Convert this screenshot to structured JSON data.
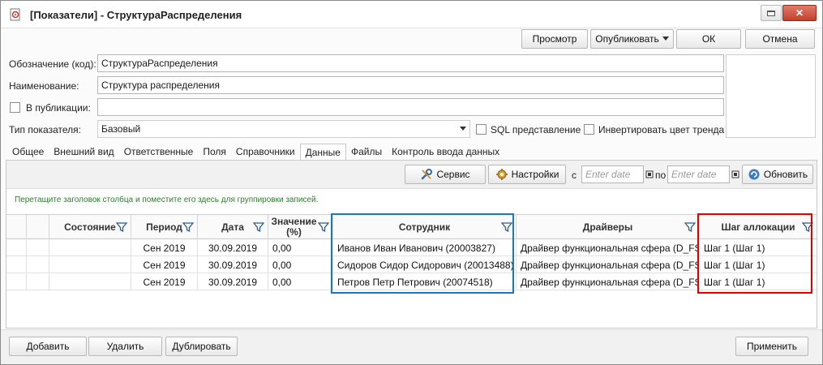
{
  "window": {
    "title": "[Показатели] - СтруктураРаспределения",
    "minimize_icon": "minimize-icon",
    "close_label": "✕"
  },
  "top_buttons": {
    "preview": "Просмотр",
    "publish": "Опубликовать",
    "ok": "ОК",
    "cancel": "Отмена"
  },
  "form": {
    "code_label": "Обозначение (код):",
    "code_value": "СтруктураРаспределения",
    "name_label": "Наименование:",
    "name_value": "Структура распределения",
    "publish_label": "В публикации:",
    "publish_value": "",
    "type_label": "Тип показателя:",
    "type_value": "Базовый",
    "sql_label": "SQL представление",
    "invert_label": "Инвертировать цвет тренда"
  },
  "tabs": [
    "Общее",
    "Внешний вид",
    "Ответственные",
    "Поля",
    "Справочники",
    "Данные",
    "Файлы",
    "Контроль ввода данных"
  ],
  "active_tab": "Данные",
  "toolbar": {
    "service": "Сервис",
    "settings": "Настройки",
    "from": "с",
    "date_placeholder": "Enter date",
    "to": "по",
    "refresh": "Обновить"
  },
  "group_hint": "Перетащите заголовок столбца и поместите его здесь для группировки записей.",
  "grid": {
    "columns": [
      "Состояние",
      "Период",
      "Дата",
      "Значение (%)",
      "Сотрудник",
      "Драйверы",
      "Шаг аллокации"
    ],
    "rows": [
      [
        "",
        "Сен 2019",
        "30.09.2019",
        "0,00",
        "Иванов Иван Иванович (20003827)",
        "Драйвер функциональная сфера (D_FS)",
        "Шаг 1 (Шаг 1)"
      ],
      [
        "",
        "Сен 2019",
        "30.09.2019",
        "0,00",
        "Сидоров Сидор Сидорович (20013488)",
        "Драйвер функциональная сфера (D_FS)",
        "Шаг 1 (Шаг 1)"
      ],
      [
        "",
        "Сен 2019",
        "30.09.2019",
        "0,00",
        "Петров Петр Петрович (20074518)",
        "Драйвер функциональная сфера (D_FS)",
        "Шаг 1 (Шаг 1)"
      ]
    ]
  },
  "bottom_buttons": {
    "add": "Добавить",
    "delete": "Удалить",
    "duplicate": "Дублировать",
    "apply": "Применить"
  },
  "colors": {
    "highlight_blue": "#1f77b4",
    "highlight_red": "#e00000"
  }
}
